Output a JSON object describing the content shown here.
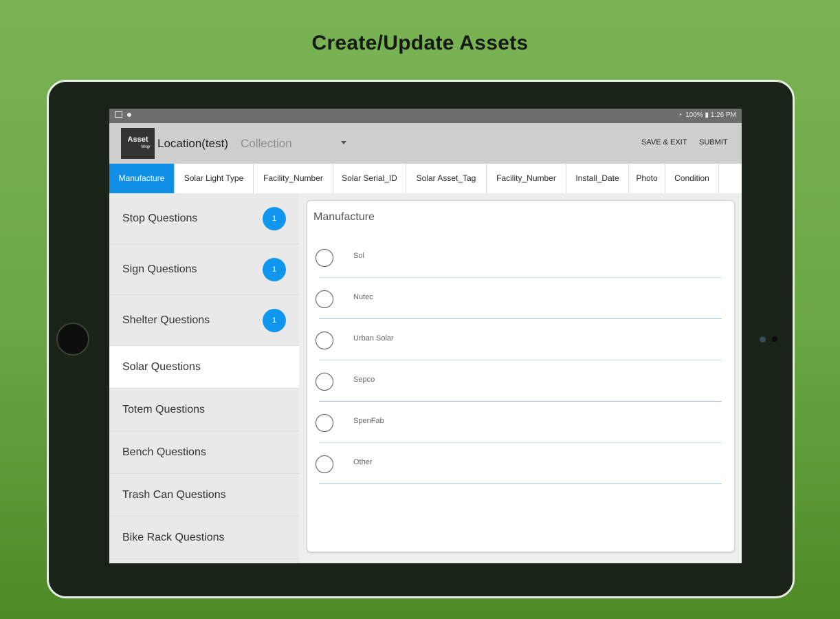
{
  "headline": "Create/Update Assets",
  "status_bar": {
    "right_text": "100% ▮ 1:26 PM"
  },
  "app_bar": {
    "logo_line1": "Asset",
    "logo_line2": "Mngr",
    "location_title": "Location(test)",
    "collection_select": "Collection",
    "save_exit_label": "SAVE & EXIT",
    "submit_label": "SUBMIT"
  },
  "tabs": [
    {
      "label": "Manufacture",
      "active": true
    },
    {
      "label": "Solar Light Type"
    },
    {
      "label": "Facility_Number"
    },
    {
      "label": "Solar Serial_ID"
    },
    {
      "label": "Solar Asset_Tag"
    },
    {
      "label": "Facility_Number"
    },
    {
      "label": "Install_Date"
    },
    {
      "label": "Photo"
    },
    {
      "label": "Condition"
    }
  ],
  "sidebar": {
    "items": [
      {
        "label": "Stop Questions",
        "badge": "1"
      },
      {
        "label": "Sign Questions",
        "badge": "1"
      },
      {
        "label": "Shelter Questions",
        "badge": "1"
      },
      {
        "label": "Solar Questions",
        "active": true
      },
      {
        "label": "Totem Questions"
      },
      {
        "label": "Bench Questions"
      },
      {
        "label": "Trash Can Questions"
      },
      {
        "label": "Bike Rack Questions"
      }
    ]
  },
  "question": {
    "title": "Manufacture",
    "options": [
      "Sol",
      "Nutec",
      "Urban Solar",
      "Sepco",
      "SpenFab",
      "Other"
    ]
  },
  "colors": {
    "accent": "#0f8fe5",
    "badge": "#1196ee",
    "background_green": "#6aa544",
    "tablet_bezel": "#1a2317"
  }
}
